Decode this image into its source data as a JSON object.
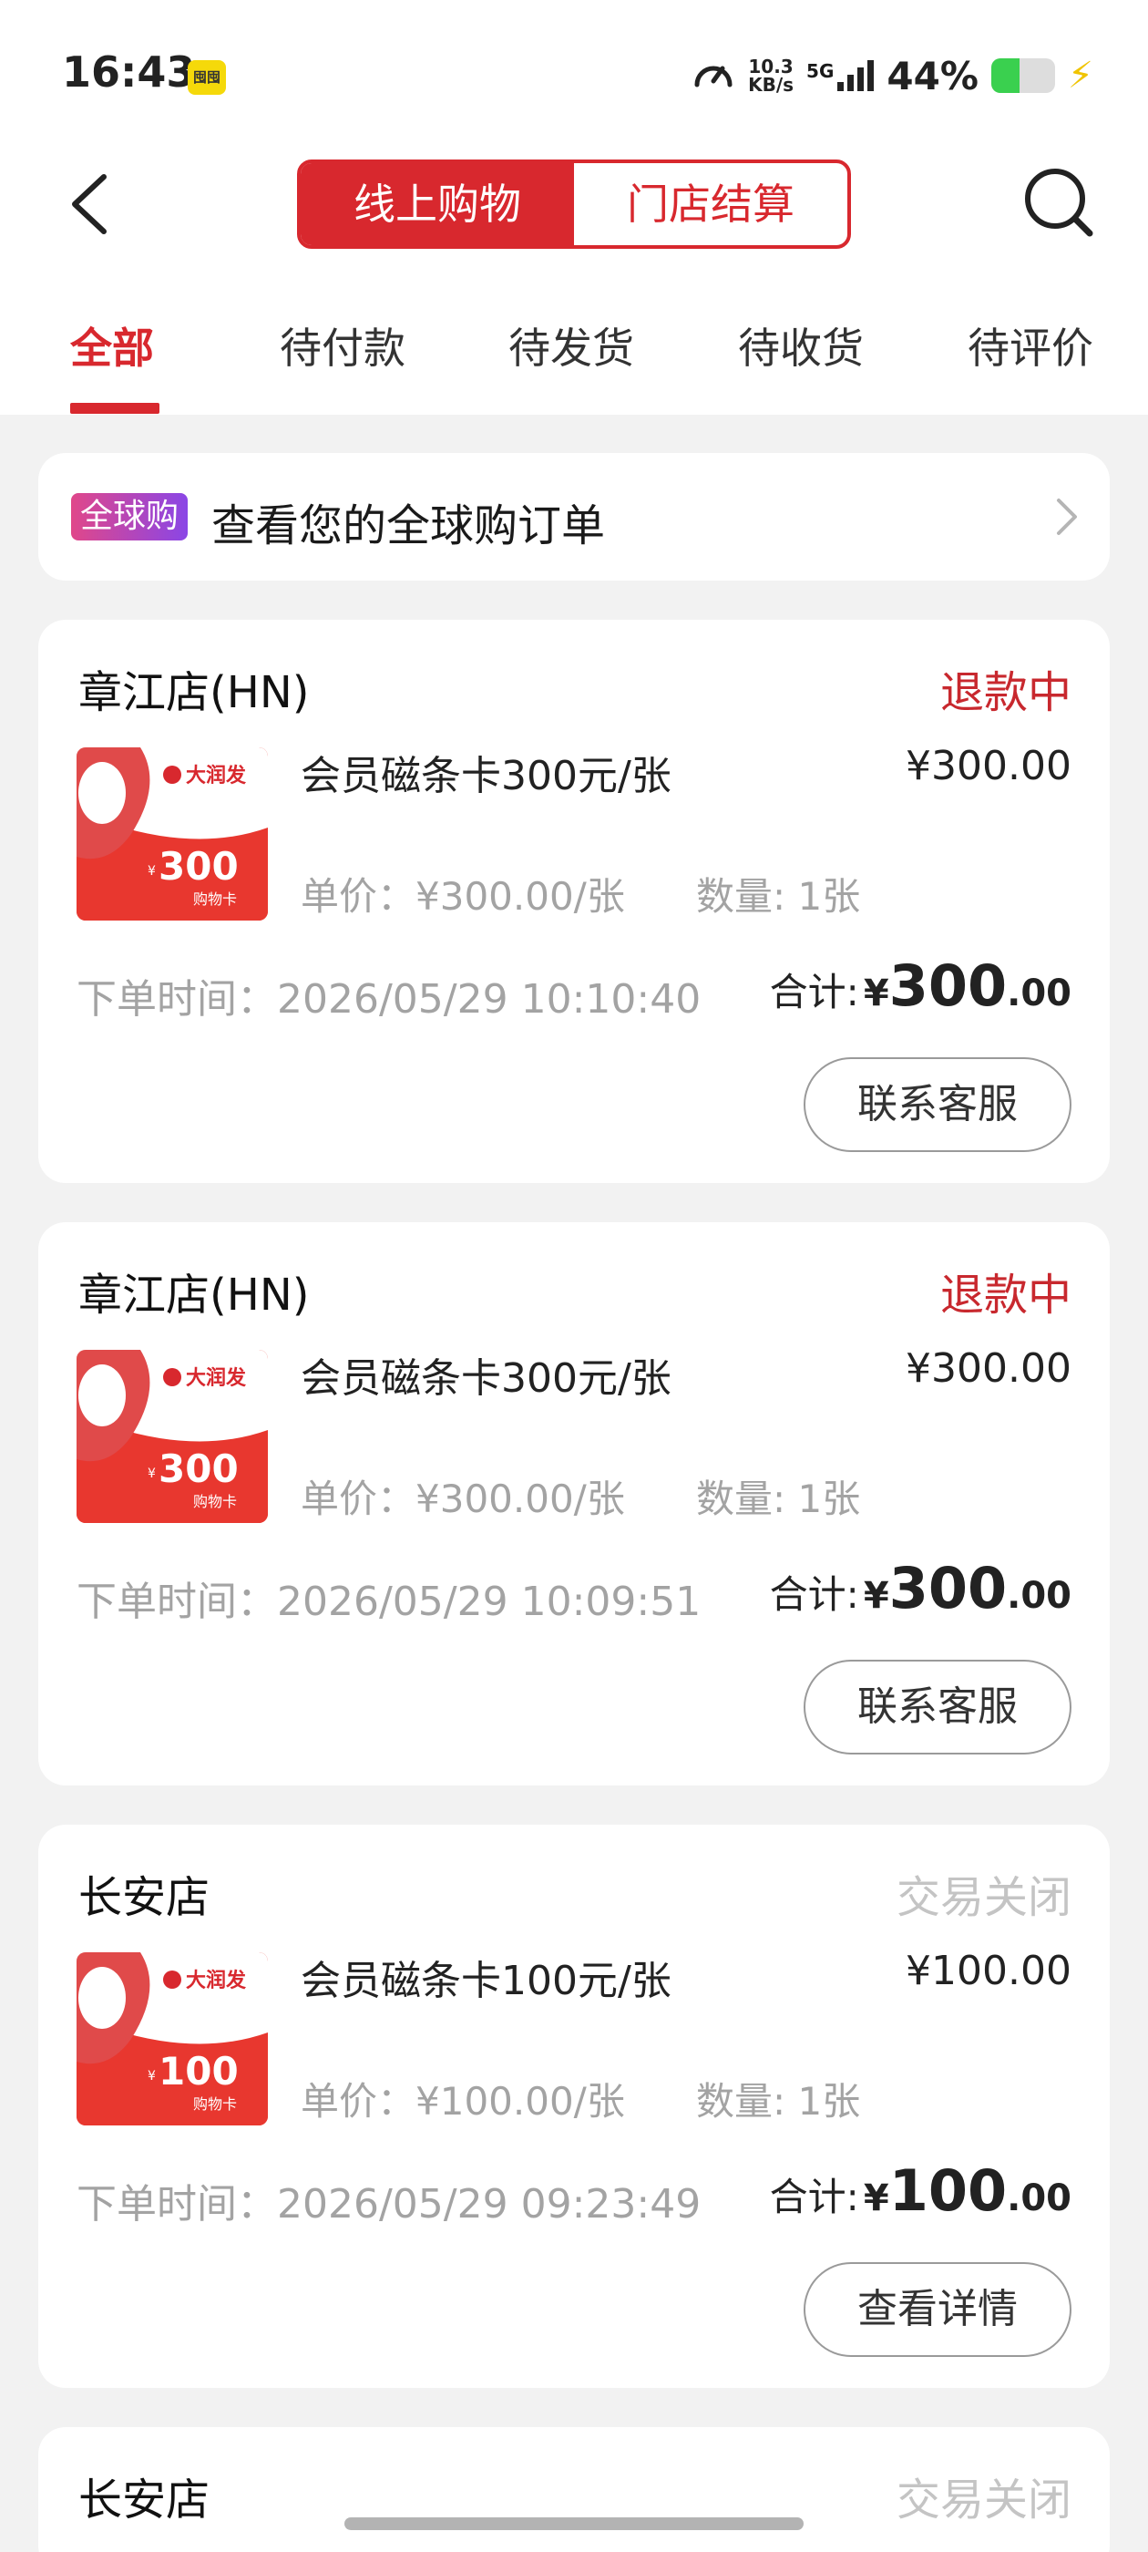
{
  "status_bar": {
    "time": "16:43",
    "badge": "囤囤",
    "net_speed_value": "10.3",
    "net_speed_unit": "KB/s",
    "network": "5G",
    "battery": "44%",
    "battery_level": 0.44,
    "battery_color": "#3ad04f"
  },
  "header": {
    "segments": [
      "线上购物",
      "门店结算"
    ],
    "active_segment": 0,
    "accent_color": "#d8282e"
  },
  "tabs": [
    "全部",
    "待付款",
    "待发货",
    "待收货",
    "待评价"
  ],
  "global_banner": {
    "badge": "全球购",
    "text": "查看您的全球购订单"
  },
  "orders": [
    {
      "store": "章江店(HN)",
      "status": "退款中",
      "status_tone": "red",
      "card_text": "300",
      "card_sub": "购物卡",
      "brand": "大润发",
      "product": "会员磁条卡300元/张",
      "price": "¥300.00",
      "unit_price": "单价：¥300.00/张",
      "quantity": "数量: 1张",
      "order_time": "下单时间：2026/05/29 10:10:40",
      "total_label": "合计:",
      "total_currency": "¥",
      "total_int": "300",
      "total_dec": ".00",
      "button": "联系客服"
    },
    {
      "store": "章江店(HN)",
      "status": "退款中",
      "status_tone": "red",
      "card_text": "300",
      "card_sub": "购物卡",
      "brand": "大润发",
      "product": "会员磁条卡300元/张",
      "price": "¥300.00",
      "unit_price": "单价：¥300.00/张",
      "quantity": "数量: 1张",
      "order_time": "下单时间：2026/05/29 10:09:51",
      "total_label": "合计:",
      "total_currency": "¥",
      "total_int": "300",
      "total_dec": ".00",
      "button": "联系客服"
    },
    {
      "store": "长安店",
      "status": "交易关闭",
      "status_tone": "grey",
      "card_text": "100",
      "card_sub": "购物卡",
      "brand": "大润发",
      "product": "会员磁条卡100元/张",
      "price": "¥100.00",
      "unit_price": "单价：¥100.00/张",
      "quantity": "数量: 1张",
      "order_time": "下单时间：2026/05/29 09:23:49",
      "total_label": "合计:",
      "total_currency": "¥",
      "total_int": "100",
      "total_dec": ".00",
      "button": "查看详情"
    },
    {
      "store": "长安店",
      "status": "交易关闭",
      "status_tone": "grey"
    }
  ]
}
